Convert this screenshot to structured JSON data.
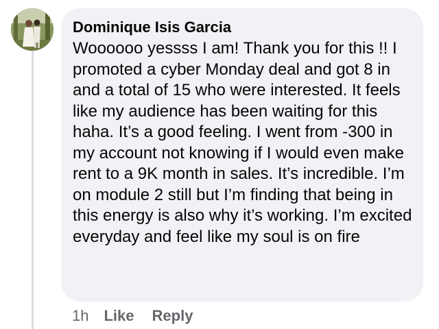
{
  "comment": {
    "author": "Dominique Isis Garcia",
    "text": "Woooooo yessss I am! Thank you for this !! I promoted a cyber Monday deal and got 8 in  and a total of 15 who were interested. It feels like my audience has been waiting for this haha. It’s a good feeling. I went from -300 in my account not knowing if I would even make rent to a 9K month in sales. It’s incredible. I’m on module 2 still but I’m finding that being in this energy is also why it’s working. I’m excited everyday and feel like my soul is on fire",
    "timestamp": "1h",
    "like_label": "Like",
    "reply_label": "Reply"
  },
  "colors": {
    "bubble_bg": "#f0f2f5",
    "meta_text": "#65676b",
    "thread_line": "#dadde1"
  }
}
